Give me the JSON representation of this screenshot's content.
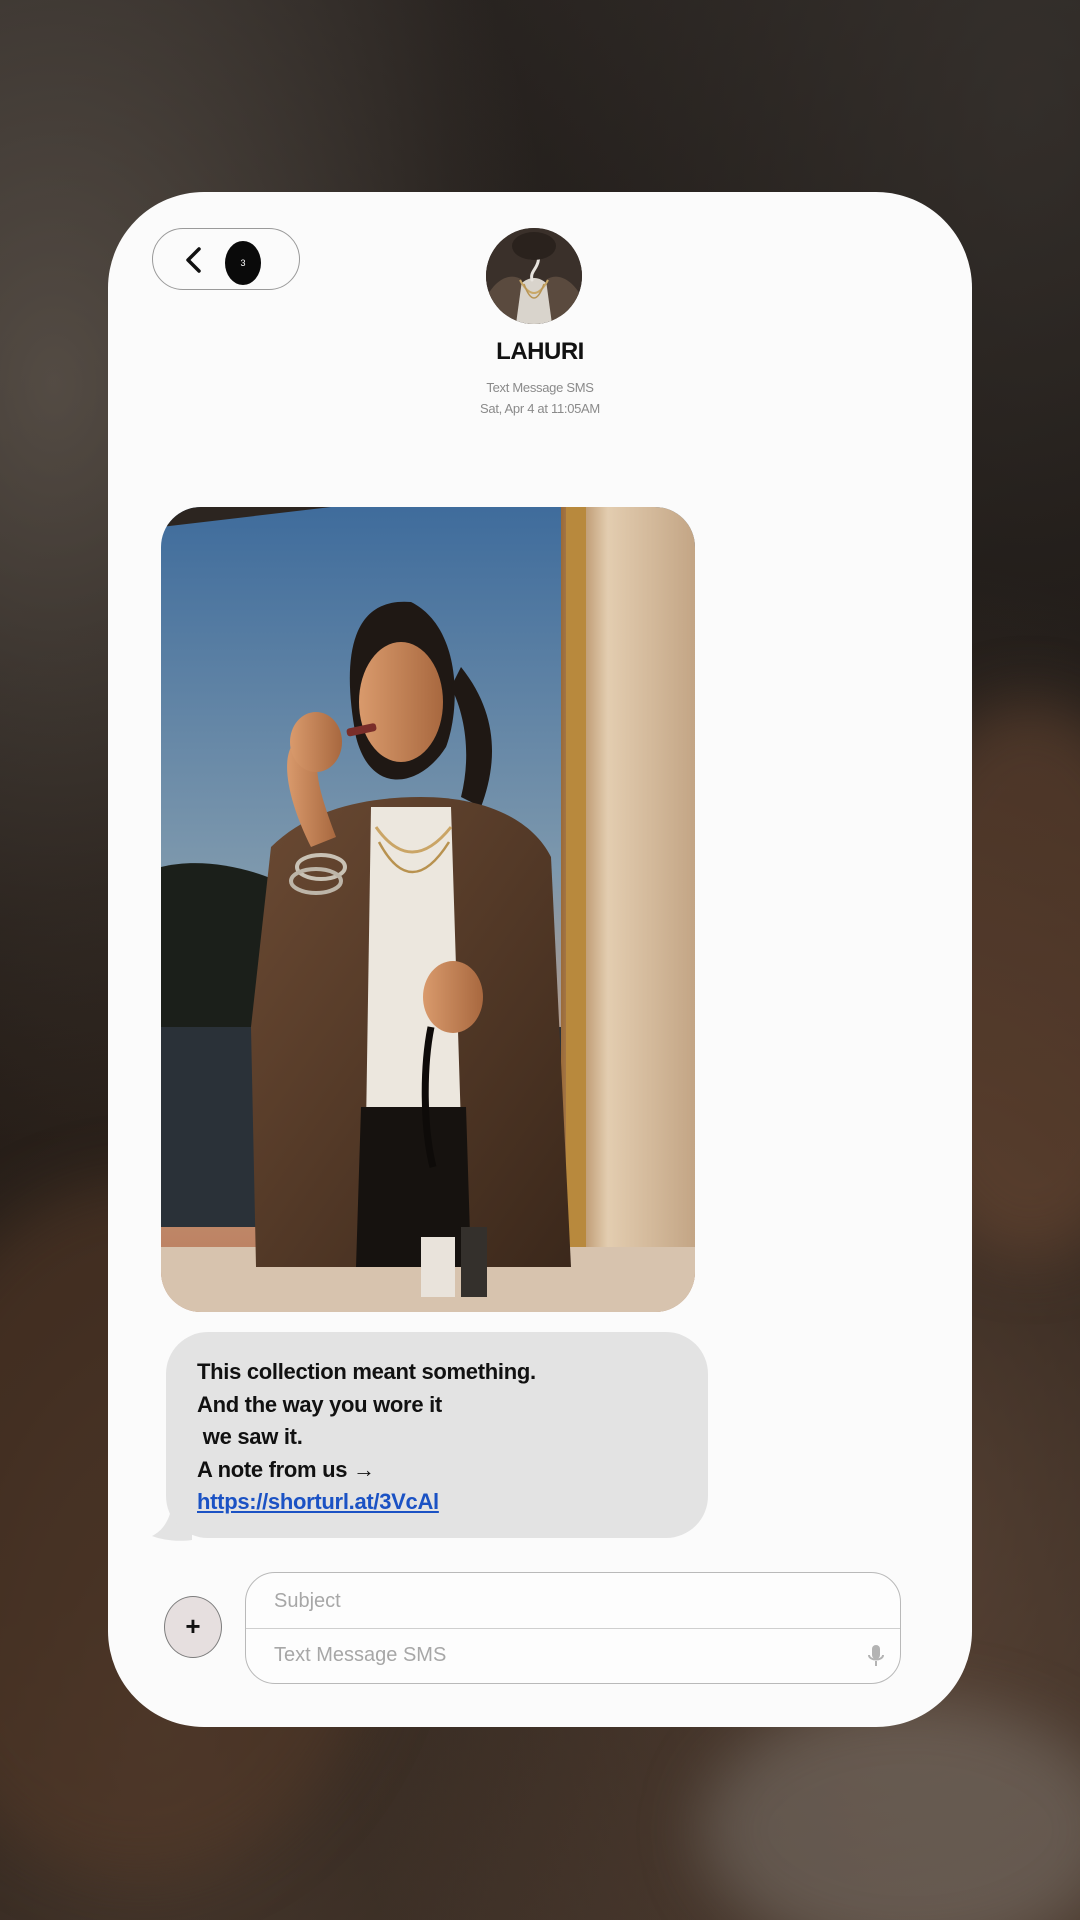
{
  "header": {
    "back_badge_count": "3",
    "contact_name": "LAHURI",
    "channel_label": "Text Message SMS",
    "timestamp": "Sat, Apr 4 at 11:05AM"
  },
  "message": {
    "lines": [
      "This collection meant something.",
      "And the way you wore it",
      " we saw it.",
      "A note from us →"
    ],
    "link": "https://shorturl.at/3VcAl"
  },
  "composer": {
    "subject_placeholder": "Subject",
    "message_placeholder": "Text Message SMS",
    "add_label": "+"
  },
  "icons": {
    "back": "chevron-left-icon",
    "mic": "microphone-icon",
    "add": "plus-icon"
  },
  "colors": {
    "bubble": "#e3e3e3",
    "link": "#1b52c4",
    "screen": "#fbfbfb"
  }
}
